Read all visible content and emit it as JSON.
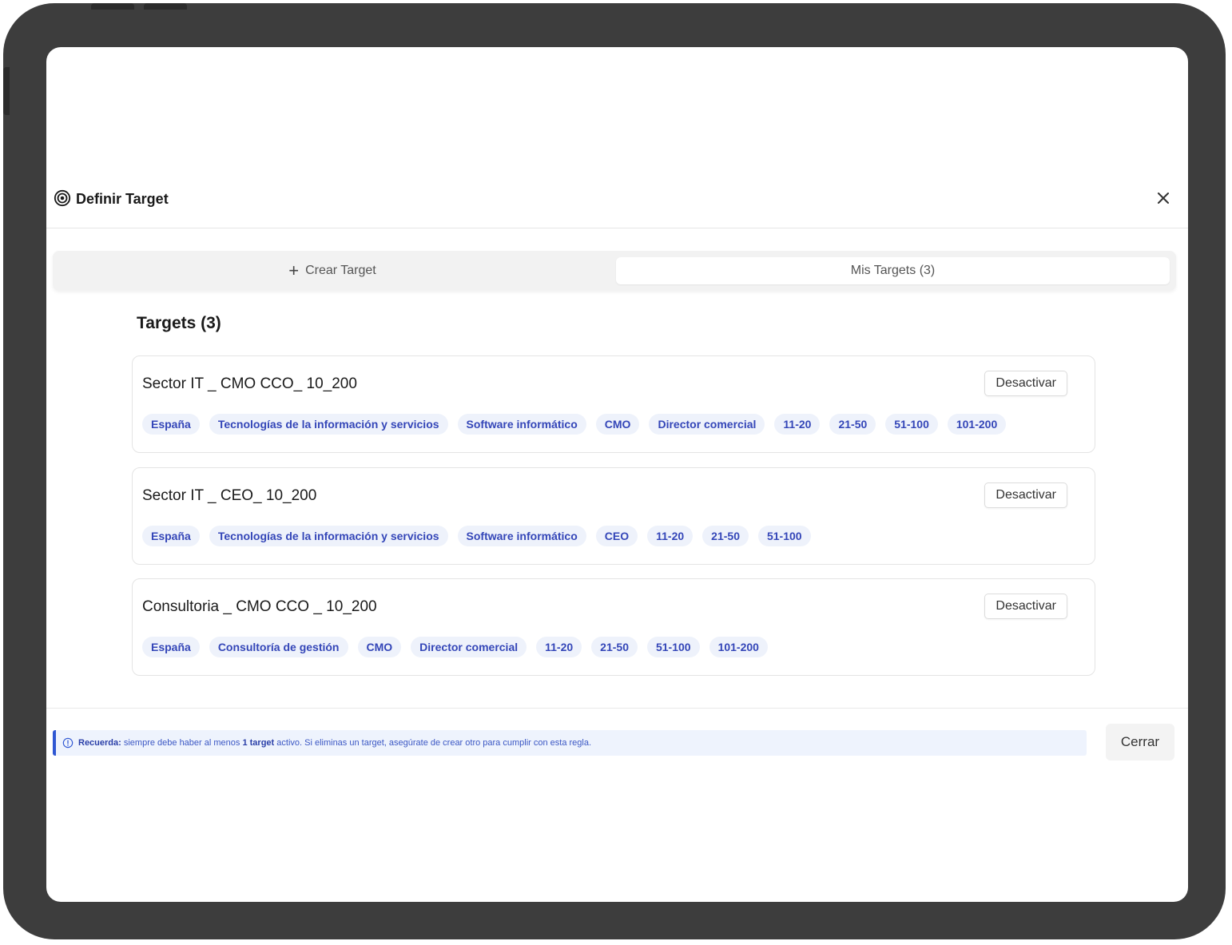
{
  "modal": {
    "title": "Definir Target",
    "header_icon": "target-icon",
    "close_icon": "close-icon"
  },
  "tabs": [
    {
      "label": "Crear Target",
      "icon": "plus-icon",
      "active": false
    },
    {
      "label": "Mis Targets (3)",
      "active": true
    }
  ],
  "section_title": "Targets (3)",
  "targets": [
    {
      "name": "Sector IT _ CMO CCO_ 10_200",
      "button_label": "Desactivar",
      "tags": [
        "España",
        "Tecnologías de la información y servicios",
        "Software informático",
        "CMO",
        "Director comercial",
        "11-20",
        "21-50",
        "51-100",
        "101-200"
      ]
    },
    {
      "name": "Sector IT _ CEO_ 10_200",
      "button_label": "Desactivar",
      "tags": [
        "España",
        "Tecnologías de la información y servicios",
        "Software informático",
        "CEO",
        "11-20",
        "21-50",
        "51-100"
      ]
    },
    {
      "name": "Consultoria _ CMO CCO _ 10_200",
      "button_label": "Desactivar",
      "tags": [
        "España",
        "Consultoría de gestión",
        "CMO",
        "Director comercial",
        "11-20",
        "21-50",
        "51-100",
        "101-200"
      ]
    }
  ],
  "footer": {
    "notice_icon": "info-icon",
    "notice_label": "Recuerda:",
    "notice_text_1": "siempre debe haber al menos",
    "notice_bold": "1 target",
    "notice_text_2": "activo. Si eliminas un target, asegúrate de crear otro para cumplir con esta regla.",
    "close_label": "Cerrar"
  },
  "colors": {
    "accent": "#2f57d3",
    "chip_bg": "#eef2fb",
    "chip_text": "#3446b8",
    "device_frame": "#3d3d3d"
  }
}
